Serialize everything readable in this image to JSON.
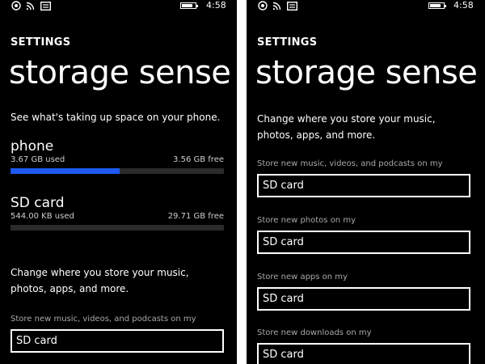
{
  "status_bar": {
    "time": "4:58",
    "icons": [
      "nfc-icon",
      "wifi-icon",
      "message-icon",
      "battery-icon"
    ],
    "battery_level": 0.85
  },
  "left_screen": {
    "section": "SETTINGS",
    "title": "storage sense",
    "intro": "See what's taking up space on your phone.",
    "devices": [
      {
        "name": "phone",
        "used": "3.67 GB used",
        "free": "3.56 GB free",
        "used_fraction": 0.51
      },
      {
        "name": "SD card",
        "used": "544.00 KB used",
        "free": "29.71 GB free",
        "used_fraction": 0.0
      }
    ],
    "change_text": "Change where you store your music, photos, apps, and more.",
    "fields": [
      {
        "label": "Store new music, videos, and podcasts on my",
        "value": "SD card"
      }
    ]
  },
  "right_screen": {
    "section": "SETTINGS",
    "title": "storage sense",
    "change_text": "Change where you store your music, photos, apps, and more.",
    "fields": [
      {
        "label": "Store new music, videos, and podcasts on my",
        "value": "SD card"
      },
      {
        "label": "Store new photos on my",
        "value": "SD card"
      },
      {
        "label": "Store new apps on my",
        "value": "SD card"
      },
      {
        "label": "Store new downloads on my",
        "value": "SD card"
      }
    ]
  },
  "colors": {
    "background": "#000000",
    "accent": "#1f59f0",
    "text": "#ffffff",
    "secondary_text": "#a8a8a8"
  }
}
